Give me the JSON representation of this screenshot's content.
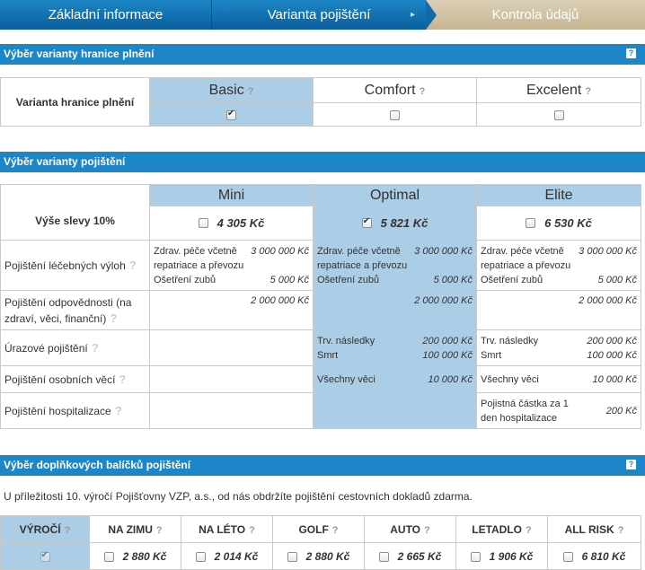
{
  "steps": [
    {
      "label": "Základní informace"
    },
    {
      "label": "Varianta pojištění"
    },
    {
      "label": "Kontrola údajů"
    }
  ],
  "section1": {
    "title": "Výběr varianty hranice plnění",
    "row_label": "Varianta hranice plnění",
    "variants": [
      {
        "label": "Basic",
        "checked": true
      },
      {
        "label": "Comfort",
        "checked": false
      },
      {
        "label": "Excelent",
        "checked": false
      }
    ]
  },
  "section2": {
    "title": "Výběr varianty pojištění",
    "discount_label": "Výše slevy 10%",
    "variants": [
      {
        "label": "Mini",
        "price": "4 305 Kč",
        "checked": false
      },
      {
        "label": "Optimal",
        "price": "5 821 Kč",
        "checked": true
      },
      {
        "label": "Elite",
        "price": "6 530 Kč",
        "checked": false
      }
    ],
    "rows": [
      {
        "label": "Pojištění léčebných výloh",
        "cells": [
          {
            "lines": [
              {
                "text": "Zdrav. péče včetně repatriace a převozu",
                "amount": "3 000 000 Kč"
              },
              {
                "text": "Ošetření zubů",
                "amount": "5 000 Kč"
              }
            ]
          },
          {
            "lines": [
              {
                "text": "Zdrav. péče včetně repatriace a převozu",
                "amount": "3 000 000 Kč"
              },
              {
                "text": "Ošetření zubů",
                "amount": "5 000 Kč"
              }
            ]
          },
          {
            "lines": [
              {
                "text": "Zdrav. péče včetně repatriace a převozu",
                "amount": "3 000 000 Kč"
              },
              {
                "text": "Ošetření zubů",
                "amount": "5 000 Kč"
              }
            ]
          }
        ]
      },
      {
        "label": "Pojištění odpovědnosti (na zdraví, věci, finanční)",
        "cells": [
          {
            "lines": [
              {
                "text": "",
                "amount": "2 000 000 Kč"
              }
            ]
          },
          {
            "lines": [
              {
                "text": "",
                "amount": "2 000 000 Kč"
              }
            ]
          },
          {
            "lines": [
              {
                "text": "",
                "amount": "2 000 000 Kč"
              }
            ]
          }
        ]
      },
      {
        "label": "Úrazové pojištění",
        "cells": [
          {
            "lines": []
          },
          {
            "lines": [
              {
                "text": "Trv. následky",
                "amount": "200 000 Kč"
              },
              {
                "text": "Smrt",
                "amount": "100 000 Kč"
              }
            ]
          },
          {
            "lines": [
              {
                "text": "Trv. následky",
                "amount": "200 000 Kč"
              },
              {
                "text": "Smrt",
                "amount": "100 000 Kč"
              }
            ]
          }
        ]
      },
      {
        "label": "Pojištění osobních věcí",
        "cells": [
          {
            "lines": []
          },
          {
            "lines": [
              {
                "text": "Všechny věci",
                "amount": "10 000 Kč"
              }
            ]
          },
          {
            "lines": [
              {
                "text": "Všechny věci",
                "amount": "10 000 Kč"
              }
            ]
          }
        ]
      },
      {
        "label": "Pojištění hospitalizace",
        "cells": [
          {
            "lines": []
          },
          {
            "lines": []
          },
          {
            "lines": [
              {
                "text": "Pojistná částka za 1 den hospitalizace",
                "amount": "200 Kč"
              }
            ]
          }
        ]
      }
    ]
  },
  "section3": {
    "title": "Výběr doplňkových balíčků pojištění",
    "intro": "U příležitosti 10. výročí Pojišťovny VZP, a.s., od nás obdržíte pojištění cestovních dokladů zdarma.",
    "packages": [
      {
        "label": "VÝROČÍ",
        "price": "",
        "checked": true
      },
      {
        "label": "NA ZIMU",
        "price": "2 880 Kč",
        "checked": false
      },
      {
        "label": "NA LÉTO",
        "price": "2 014 Kč",
        "checked": false
      },
      {
        "label": "GOLF",
        "price": "2 880 Kč",
        "checked": false
      },
      {
        "label": "AUTO",
        "price": "2 665 Kč",
        "checked": false
      },
      {
        "label": "LETADLO",
        "price": "1 906 Kč",
        "checked": false
      },
      {
        "label": "ALL RISK",
        "price": "6 810 Kč",
        "checked": false
      }
    ]
  },
  "icons": {
    "help": "question-mark-icon",
    "help_box": "help-box-icon"
  },
  "colors": {
    "primary": "#1c86c8",
    "selected_cell": "#abcde5",
    "current_step": "#c5b591"
  }
}
